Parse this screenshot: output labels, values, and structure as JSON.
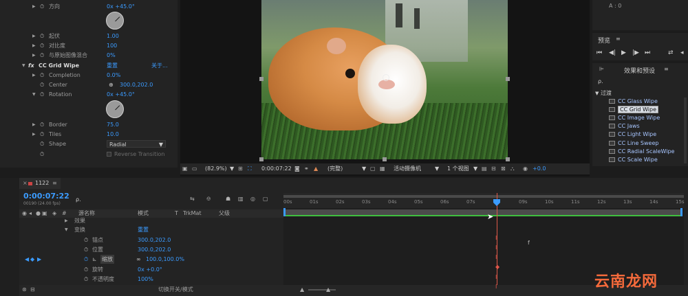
{
  "effects_controls": {
    "rows": [
      {
        "label": "方向",
        "value": "0x +45.0°"
      },
      {
        "label": "起伏",
        "value": "1.00"
      },
      {
        "label": "对比度",
        "value": "100"
      },
      {
        "label": "与原始图像混合",
        "value": "0%"
      }
    ],
    "effect_name": "CC Grid Wipe",
    "reset_label": "重置",
    "about_label": "关于...",
    "fx_label": "fx",
    "props": [
      {
        "label": "Completion",
        "value": "0.0%"
      },
      {
        "label": "Center",
        "value": "300.0,202.0"
      },
      {
        "label": "Rotation",
        "value": "0x +45.0°"
      },
      {
        "label": "Border",
        "value": "75.0"
      },
      {
        "label": "Tiles",
        "value": "10.0"
      },
      {
        "label": "Shape",
        "value": "Radial"
      }
    ],
    "reverse_label": "Reverse Transition"
  },
  "composition_viewer": {
    "zoom": "(82.9%)",
    "timecode": "0:00:07:22",
    "quality": "(完整)",
    "camera": "活动摄像机",
    "views": "1 个视图",
    "exposure": "+0.0"
  },
  "preview_panel": {
    "title": "预览",
    "info_a": "A : 0"
  },
  "effects_presets": {
    "title": "效果和预设",
    "search_icon": "ρ.",
    "category": "过渡",
    "items": [
      "CC Glass Wipe",
      "CC Grid Wipe",
      "CC Image Wipe",
      "CC Jaws",
      "CC Light Wipe",
      "CC Line Sweep",
      "CC Radial ScaleWipe",
      "CC Scale Wipe"
    ],
    "selected_index": 1
  },
  "timeline": {
    "comp_tab": "1122",
    "timecode": "0:00:07:22",
    "frame_info": "00190 (24.00 fps)",
    "search_icon": "ρ.",
    "columns": {
      "hash": "#",
      "source_name": "源名称",
      "mode": "模式",
      "t": "T",
      "trkmat": "TrkMat",
      "parent": "父级"
    },
    "rows": [
      {
        "label": "效果",
        "value": ""
      },
      {
        "label": "变换",
        "value": "重置"
      },
      {
        "label": "锚点",
        "value": "300.0,202.0"
      },
      {
        "label": "位置",
        "value": "300.0,202.0"
      },
      {
        "label": "缩放",
        "value": "100.0,100.0%"
      },
      {
        "label": "旋转",
        "value": "0x +0.0°"
      },
      {
        "label": "不透明度",
        "value": "100%"
      }
    ],
    "ruler": [
      "0s",
      "01s",
      "02s",
      "03s",
      "04s",
      "05s",
      "06s",
      "07s",
      "",
      "09s",
      "10s",
      "11s",
      "12s",
      "13s",
      "14s",
      "15s"
    ],
    "ruler_start": "00s",
    "toggle_label": "切换开关/模式",
    "playhead_position": 0.7
  },
  "watermark": "云南龙网"
}
